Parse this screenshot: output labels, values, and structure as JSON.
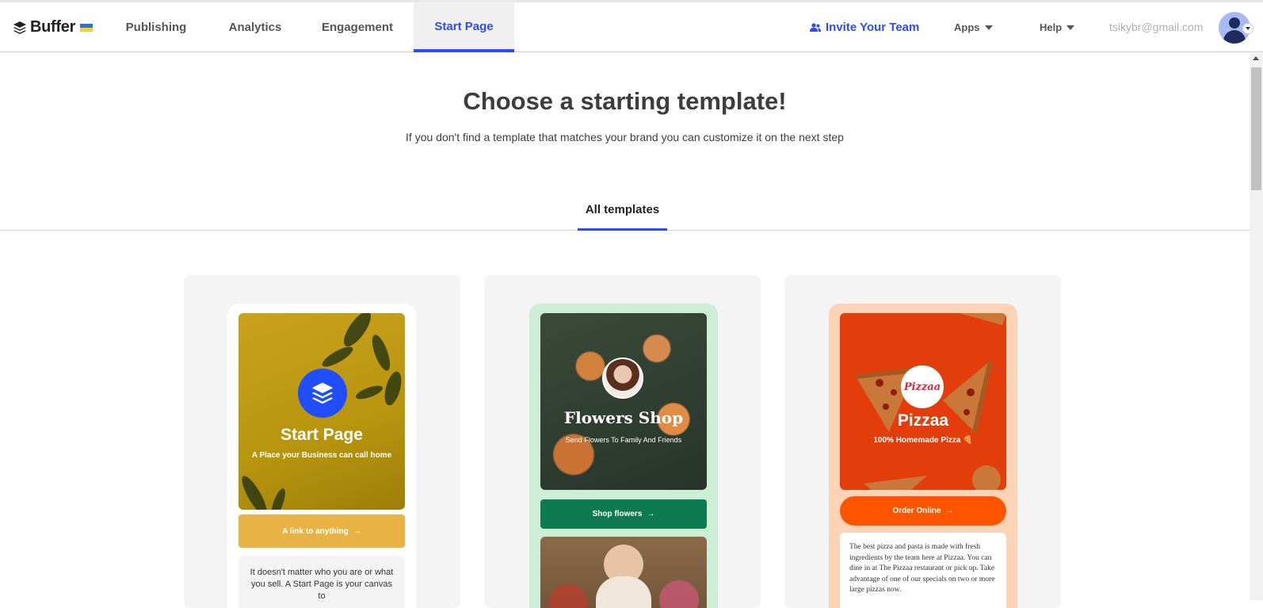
{
  "app": {
    "name": "Buffer"
  },
  "nav": {
    "tabs": [
      "Publishing",
      "Analytics",
      "Engagement",
      "Start Page"
    ],
    "active_tab": "Start Page",
    "invite_label": "Invite Your Team",
    "apps_label": "Apps",
    "help_label": "Help",
    "email": "tsikybr@gmail.com"
  },
  "page": {
    "title": "Choose a starting template!",
    "subtitle": "If you don't find a template that matches your brand you can customize it on the next step",
    "filter_tab": "All templates"
  },
  "templates": [
    {
      "title": "Start Page",
      "subtitle": "A Place your Business can call home",
      "cta": "A link to anything",
      "body": "It doesn't matter who you are or what you sell. A Start Page is your canvas to"
    },
    {
      "title": "Flowers Shop",
      "subtitle": "Send Flowers To Family And Friends",
      "cta": "Shop flowers"
    },
    {
      "logo": "Pizzaa",
      "title": "Pizzaa",
      "subtitle": "100% Homemade Pizza 🍕",
      "cta": "Order Online",
      "body": "The best pizza and pasta is made with fresh ingredients by the team here at Pizzaa. You can dine in at The Pizzaa restaurant or pick up. Take advantage of one of our specials on two or more large pizzas now."
    }
  ],
  "colors": {
    "accent": "#2c4bff",
    "start_page_bg": "#b8950e",
    "start_page_cta": "#e8b244",
    "flowers_frame": "#cdeed6",
    "flowers_cta": "#0d7a4f",
    "pizza_frame": "#fdd3b8",
    "pizza_bg": "#e23d0b",
    "pizza_cta": "#ff5500"
  },
  "icons": [
    "buffer-logo-icon",
    "ukraine-flag-icon",
    "users-icon",
    "chevron-down-icon",
    "avatar-icon",
    "arrow-right-icon",
    "layers-icon"
  ]
}
